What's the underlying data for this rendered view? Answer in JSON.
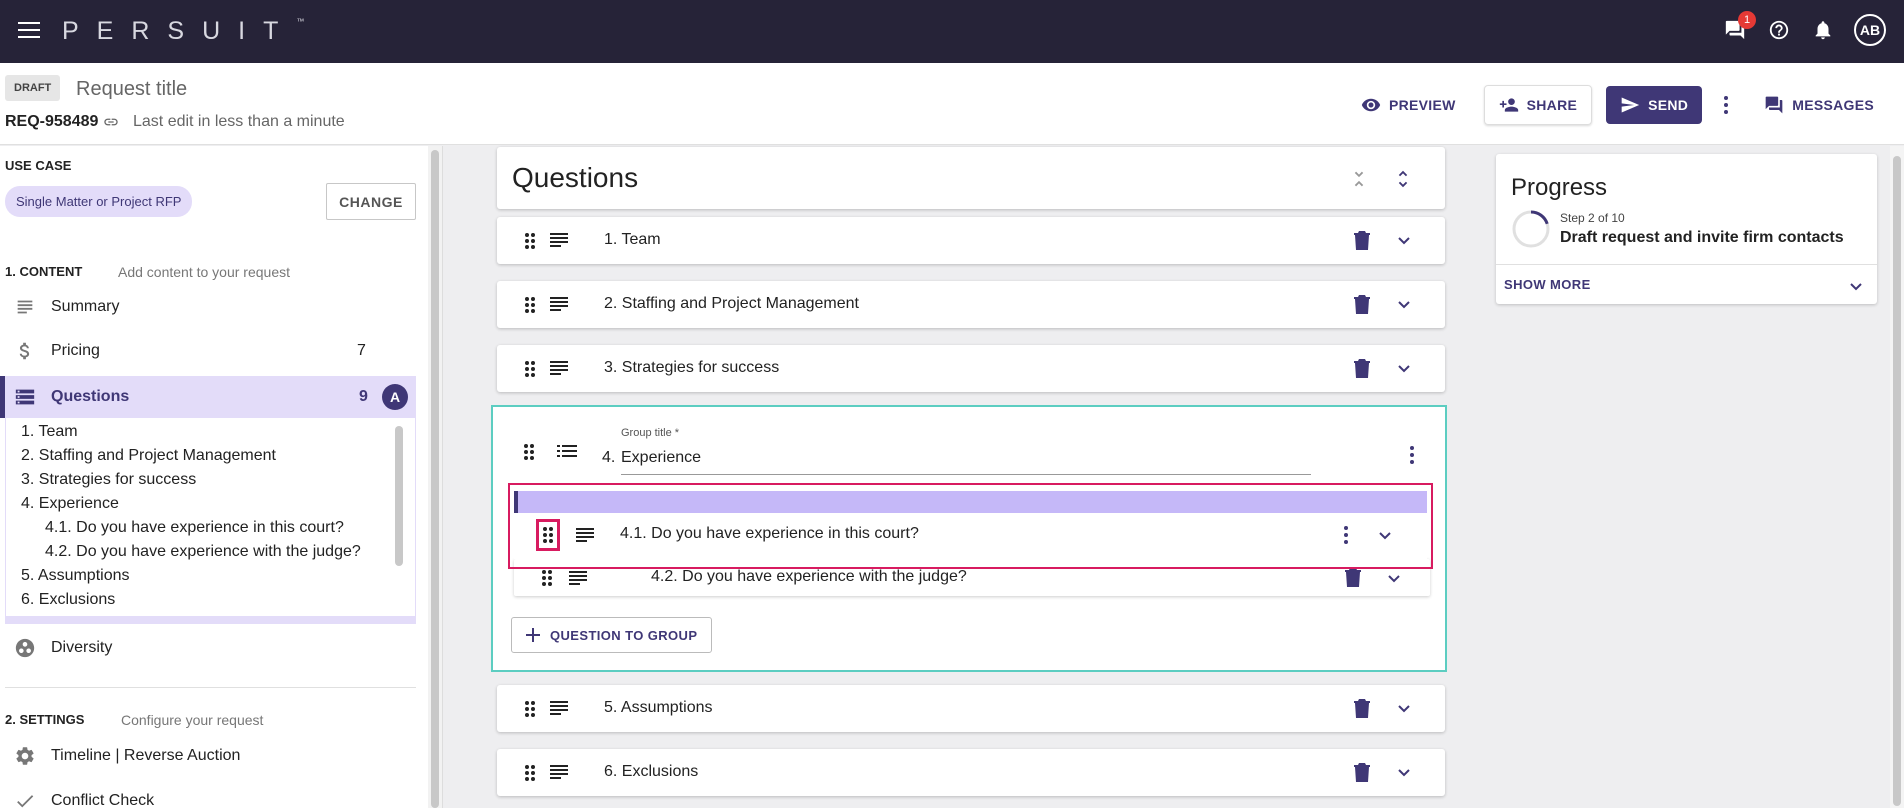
{
  "topbar": {
    "brand": "PERSUIT",
    "brand_tm": "™",
    "chat_badge": "1",
    "avatar": "AB",
    "icons": [
      "menu-icon",
      "chat-icon",
      "help-icon",
      "bell-icon"
    ]
  },
  "header": {
    "status": "DRAFT",
    "title_placeholder": "Request title",
    "request_id": "REQ-958489",
    "last_edit": "Last edit in less than a minute",
    "actions": {
      "preview": "PREVIEW",
      "share": "SHARE",
      "send": "SEND",
      "messages": "MESSAGES"
    }
  },
  "sidebar": {
    "use_case_label": "USE CASE",
    "use_case_value": "Single Matter or Project RFP",
    "change_label": "CHANGE",
    "content_section": {
      "label": "1. CONTENT",
      "sub": "Add content to your request"
    },
    "items": [
      {
        "label": "Summary",
        "count": ""
      },
      {
        "label": "Pricing",
        "count": "7"
      },
      {
        "label": "Questions",
        "count": "9",
        "badge": "A"
      },
      {
        "label": "Diversity",
        "count": ""
      }
    ],
    "questions_list": [
      "1. Team",
      "2. Staffing and Project Management",
      "3. Strategies for success",
      "4. Experience",
      "4.1. Do you have experience in this court?",
      "4.2. Do you have experience with the judge?",
      "5. Assumptions",
      "6. Exclusions"
    ],
    "settings_section": {
      "label": "2. SETTINGS",
      "sub": "Configure your request"
    },
    "settings_items": [
      {
        "label": "Timeline | Reverse Auction"
      },
      {
        "label": "Conflict Check"
      }
    ]
  },
  "main": {
    "questions_title": "Questions",
    "rows": [
      {
        "label": "1. Team"
      },
      {
        "label": "2. Staffing and Project Management"
      },
      {
        "label": "3. Strategies for success"
      }
    ],
    "group": {
      "field_label": "Group title *",
      "number": "4.",
      "value": "Experience",
      "sub_questions": [
        {
          "label": "4.1. Do you have experience in this court?"
        },
        {
          "label": "4.2. Do you have experience with the judge?"
        }
      ],
      "add_button": "QUESTION TO GROUP"
    },
    "rows_after": [
      {
        "label": "5. Assumptions"
      },
      {
        "label": "6. Exclusions"
      }
    ]
  },
  "progress": {
    "title": "Progress",
    "step": "Step 2 of 10",
    "description": "Draft request and invite firm contacts",
    "show_more": "SHOW MORE",
    "step_fraction": 0.2
  },
  "colors": {
    "topbar": "#262338",
    "primary": "#3f3776",
    "active_bg": "#e3dcf9",
    "group_border": "#5ccdc1",
    "drag_highlight": "#d81b60"
  }
}
